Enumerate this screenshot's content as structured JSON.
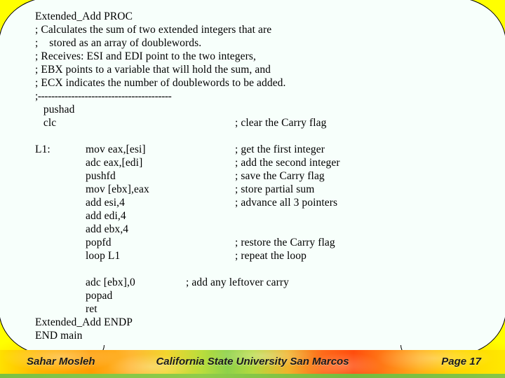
{
  "slide": {
    "background_color": "#ffff00",
    "callout_color": "#f7fffb"
  },
  "code": {
    "lines": [
      {
        "a": "Extended_Add PROC"
      },
      {
        "a": "; Calculates the sum of two extended integers that are"
      },
      {
        "a": ";    stored as an array of doublewords."
      },
      {
        "a": "; Receives: ESI and EDI point to the two integers,"
      },
      {
        "a": "; EBX points to a variable that will hold the sum, and"
      },
      {
        "a": "; ECX indicates the number of doublewords to be added."
      },
      {
        "dash": ";----------------------------------------"
      },
      {
        "a": "   pushad"
      },
      {
        "a": "   clc",
        "c": "; clear the Carry flag"
      },
      {
        "blank": true
      },
      {
        "a": "L1:",
        "b": "mov eax,[esi]",
        "c": "; get the first integer"
      },
      {
        "b": "adc eax,[edi]",
        "c": "; add the second integer"
      },
      {
        "b": "pushfd",
        "c": "; save the Carry flag"
      },
      {
        "b": "mov [ebx],eax",
        "c": "; store partial sum"
      },
      {
        "b": "add esi,4",
        "c": "; advance all 3 pointers"
      },
      {
        "b": "add edi,4"
      },
      {
        "b": "add ebx,4"
      },
      {
        "b": "popfd",
        "c": "; restore the Carry flag"
      },
      {
        "b": "loop L1",
        "c": "; repeat the loop"
      },
      {
        "blank": true
      },
      {
        "b": "adc [ebx],0",
        "d": "; add any leftover carry"
      },
      {
        "b": "popad"
      },
      {
        "b": "ret"
      },
      {
        "a": "Extended_Add ENDP"
      },
      {
        "a": "END main"
      }
    ]
  },
  "footer": {
    "author": "Sahar Mosleh",
    "center": "California State University San Marcos",
    "page": "Page 17"
  }
}
